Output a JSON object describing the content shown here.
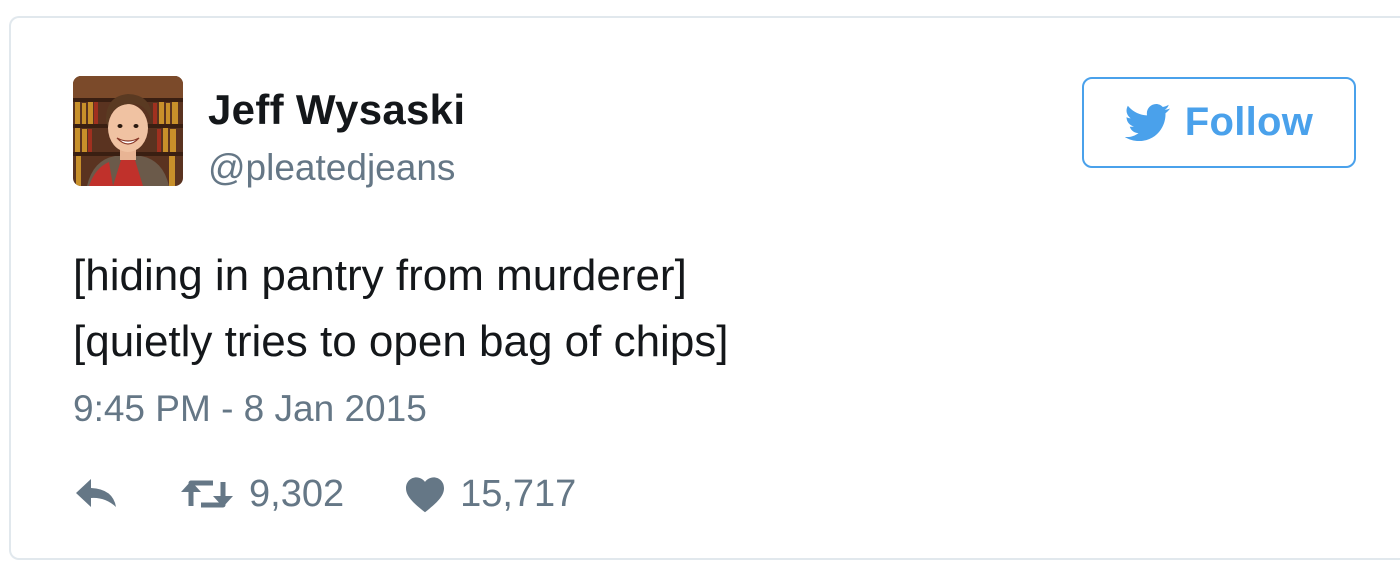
{
  "author": {
    "name": "Jeff Wysaski",
    "handle": "@pleatedjeans"
  },
  "follow_button": {
    "label": "Follow"
  },
  "tweet": {
    "lines": [
      "[hiding in pantry from murderer]",
      "[quietly tries to open bag of chips]"
    ],
    "timestamp": "9:45 PM - 8 Jan 2015"
  },
  "actions": {
    "retweet_count": "9,302",
    "like_count": "15,717"
  },
  "icons": {
    "bird": "twitter-bird-icon",
    "reply": "reply-icon",
    "retweet": "retweet-icon",
    "like": "heart-icon"
  },
  "colors": {
    "twitter_blue": "#4aa1eb",
    "text_primary": "#14171a",
    "text_secondary": "#657786",
    "border": "#e1e8ed"
  }
}
